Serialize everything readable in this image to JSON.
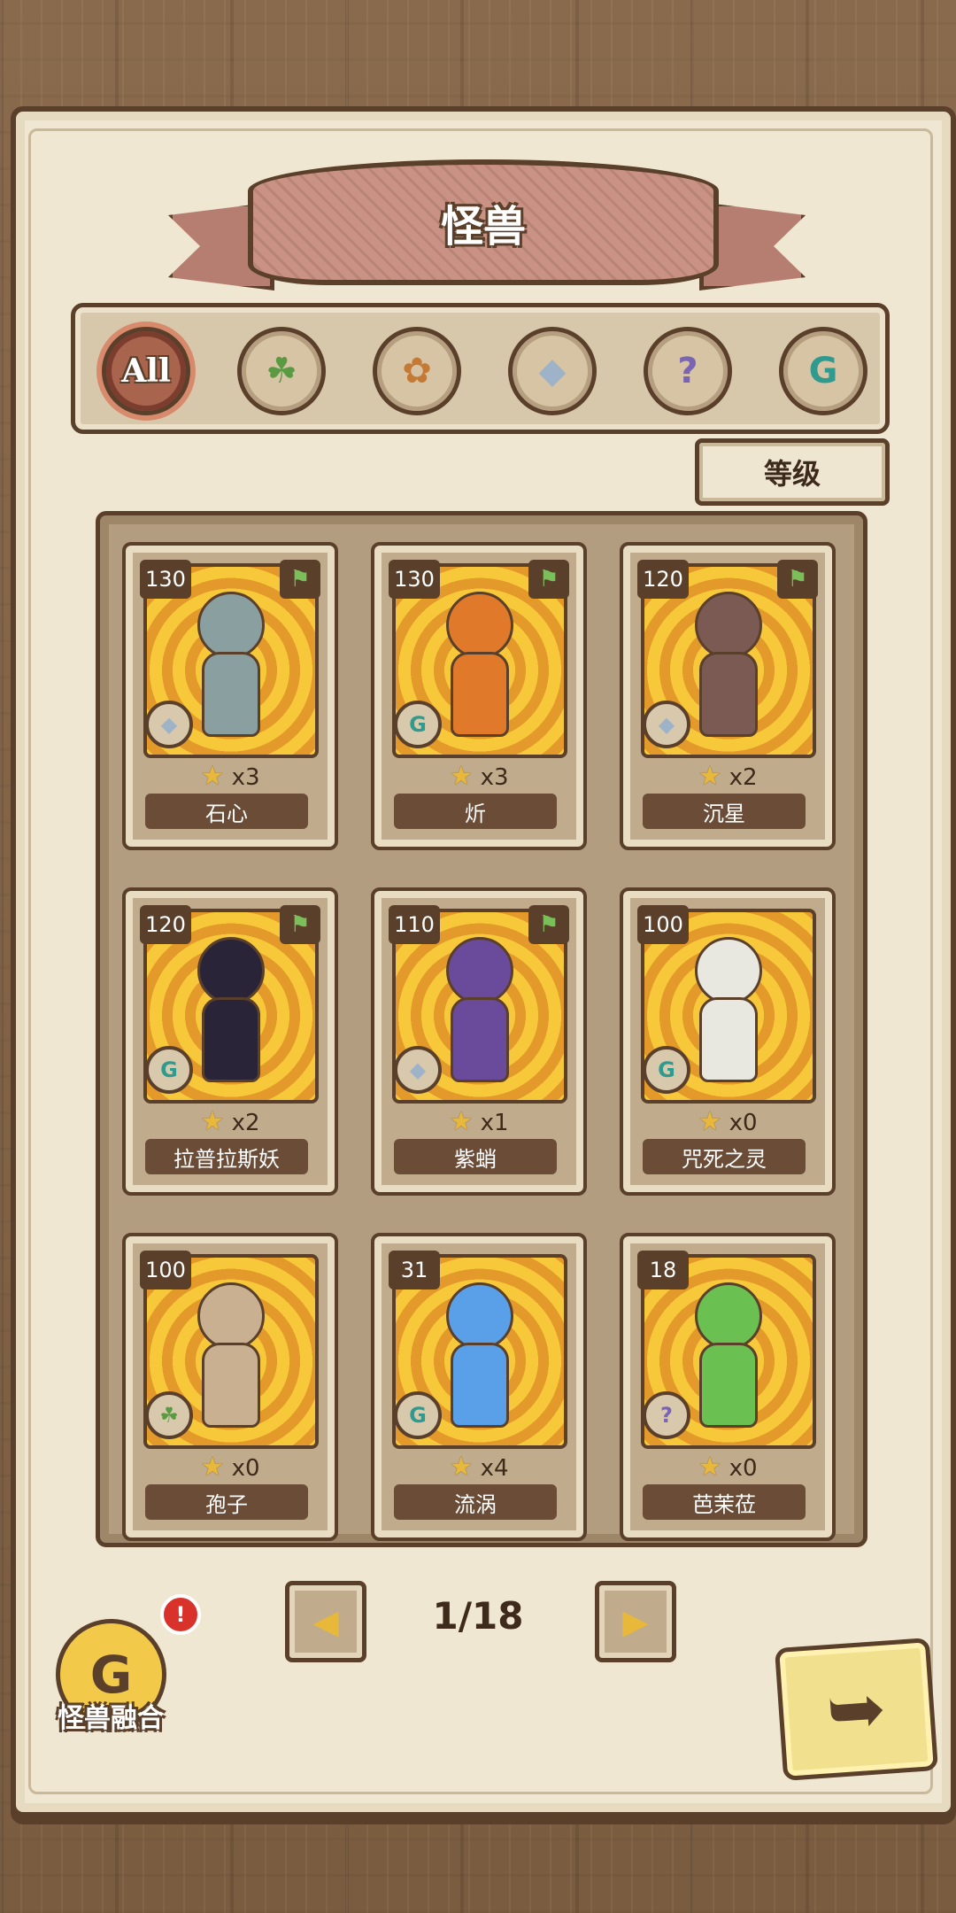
{
  "title": "怪兽",
  "filters": [
    {
      "label": "All",
      "icon": "all-icon",
      "active": true
    },
    {
      "label": "",
      "icon": "leaf-icon",
      "glyph": "☘"
    },
    {
      "label": "",
      "icon": "paw-icon",
      "glyph": "✿"
    },
    {
      "label": "",
      "icon": "crystal-icon",
      "glyph": "◆"
    },
    {
      "label": "",
      "icon": "question-icon",
      "glyph": "?"
    },
    {
      "label": "",
      "icon": "g-rune-icon",
      "glyph": "G"
    }
  ],
  "sort_label": "等级",
  "cards": [
    {
      "level": "130",
      "name": "石心",
      "stars": "x3",
      "flag": true,
      "type": "crystal",
      "type_glyph": "◆",
      "color": "#8aa0a0"
    },
    {
      "level": "130",
      "name": "炘",
      "stars": "x3",
      "flag": true,
      "type": "g-rune",
      "type_glyph": "G",
      "color": "#e07a2a"
    },
    {
      "level": "120",
      "name": "沉星",
      "stars": "x2",
      "flag": true,
      "type": "crystal",
      "type_glyph": "◆",
      "color": "#7a5a52"
    },
    {
      "level": "120",
      "name": "拉普拉斯妖",
      "stars": "x2",
      "flag": true,
      "type": "g-rune",
      "type_glyph": "G",
      "color": "#2a2438"
    },
    {
      "level": "110",
      "name": "紫蛸",
      "stars": "x1",
      "flag": true,
      "type": "crystal",
      "type_glyph": "◆",
      "color": "#6a4a9a"
    },
    {
      "level": "100",
      "name": "咒死之灵",
      "stars": "x0",
      "flag": false,
      "type": "g-rune",
      "type_glyph": "G",
      "color": "#e8e8e0"
    },
    {
      "level": "100",
      "name": "孢子",
      "stars": "x0",
      "flag": false,
      "type": "leaf",
      "type_glyph": "☘",
      "color": "#c8b090"
    },
    {
      "level": "31",
      "name": "流涡",
      "stars": "x4",
      "flag": false,
      "type": "g-rune",
      "type_glyph": "G",
      "color": "#5aa0e8"
    },
    {
      "level": "18",
      "name": "芭茉莅",
      "stars": "x0",
      "flag": false,
      "type": "question",
      "type_glyph": "?",
      "color": "#6ac050"
    }
  ],
  "pagination": {
    "indicator": "1/18",
    "prev": "◀",
    "next": "▶"
  },
  "fusion": {
    "label": "怪兽融合",
    "badge": "!",
    "glyph": "G"
  },
  "back_glyph": "➥"
}
